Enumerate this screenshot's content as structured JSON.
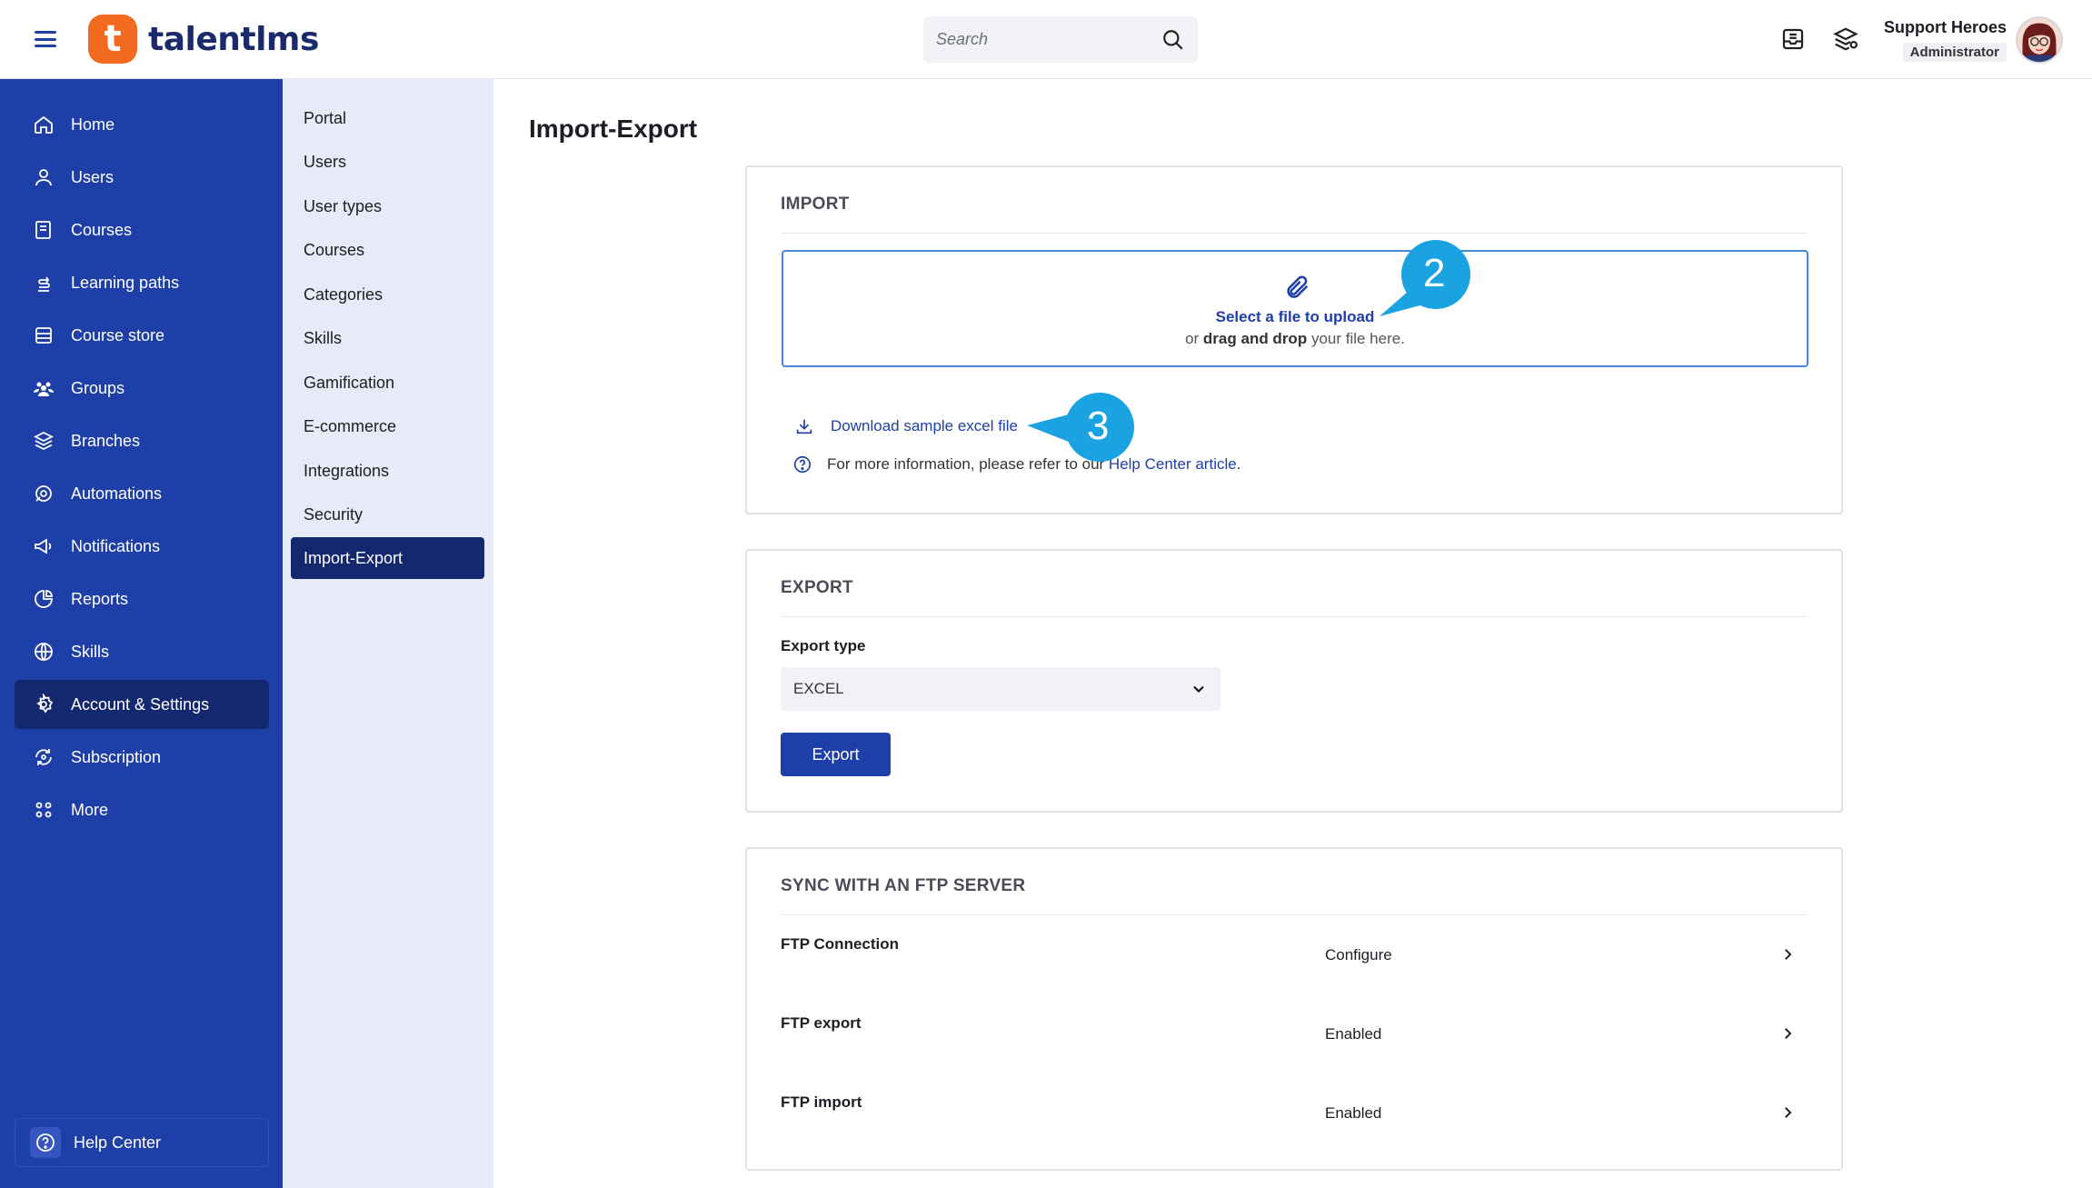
{
  "header": {
    "logo_mark": "t",
    "logo_text": "talentlms",
    "search_placeholder": "Search",
    "user_name": "Support Heroes",
    "user_role": "Administrator"
  },
  "sidebar": {
    "items": [
      {
        "label": "Home",
        "icon": "home-icon"
      },
      {
        "label": "Users",
        "icon": "user-icon"
      },
      {
        "label": "Courses",
        "icon": "book-icon"
      },
      {
        "label": "Learning paths",
        "icon": "path-icon"
      },
      {
        "label": "Course store",
        "icon": "store-icon"
      },
      {
        "label": "Groups",
        "icon": "groups-icon"
      },
      {
        "label": "Branches",
        "icon": "layers-icon"
      },
      {
        "label": "Automations",
        "icon": "automation-icon"
      },
      {
        "label": "Notifications",
        "icon": "megaphone-icon"
      },
      {
        "label": "Reports",
        "icon": "pie-chart-icon"
      },
      {
        "label": "Skills",
        "icon": "globe-icon"
      },
      {
        "label": "Account & Settings",
        "icon": "gear-icon"
      },
      {
        "label": "Subscription",
        "icon": "refresh-icon"
      },
      {
        "label": "More",
        "icon": "grid-icon"
      }
    ],
    "active": "Account & Settings",
    "help_center": "Help Center"
  },
  "subnav": {
    "items": [
      "Portal",
      "Users",
      "User types",
      "Courses",
      "Categories",
      "Skills",
      "Gamification",
      "E-commerce",
      "Integrations",
      "Security",
      "Import-Export"
    ],
    "active": "Import-Export"
  },
  "page": {
    "title": "Import-Export",
    "import": {
      "title": "IMPORT",
      "upload_primary": "Select a file to upload",
      "upload_or": "or",
      "upload_drag": "drag and drop",
      "upload_rest": "your file here.",
      "download_link": "Download sample excel file",
      "info_text": "For more information, please refer to our",
      "help_link": "Help Center article",
      "info_end": "."
    },
    "export": {
      "title": "EXPORT",
      "type_label": "Export type",
      "type_value": "EXCEL",
      "button": "Export"
    },
    "ftp": {
      "title": "SYNC WITH AN FTP SERVER",
      "rows": [
        {
          "label": "FTP Connection",
          "value": "Configure"
        },
        {
          "label": "FTP export",
          "value": "Enabled"
        },
        {
          "label": "FTP import",
          "value": "Enabled"
        }
      ]
    }
  },
  "callouts": {
    "step2": "2",
    "step3": "3",
    "color": "#1aa3e0"
  },
  "colors": {
    "brand": "#1f3fa8",
    "brand_dark": "#13286e",
    "logo_orange": "#f26b21",
    "subnav_bg": "#e6ebf7"
  }
}
